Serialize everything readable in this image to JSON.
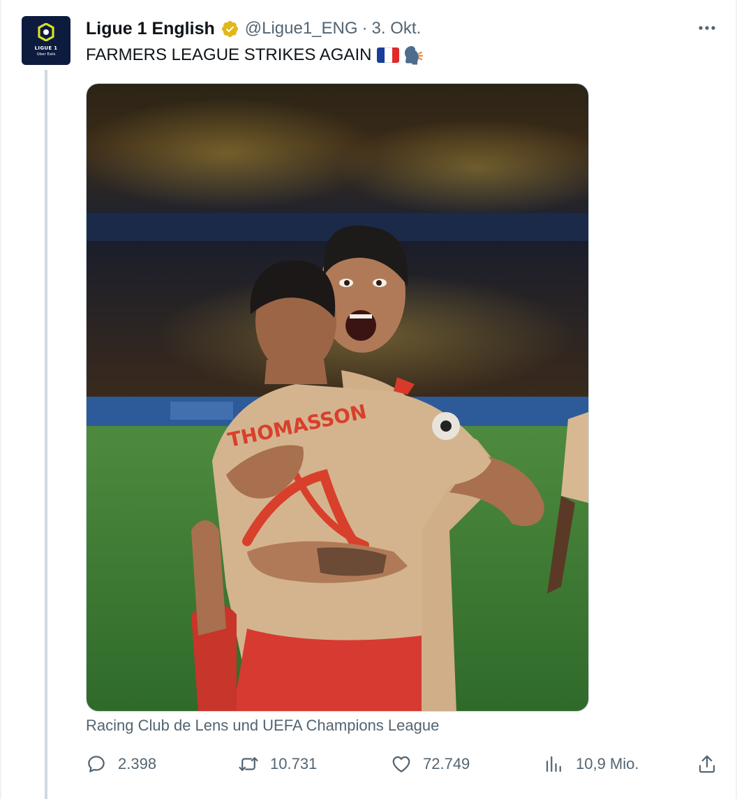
{
  "account": {
    "name": "Ligue 1 English",
    "handle": "@Ligue1_ENG",
    "separator": "·",
    "date": "3. Okt.",
    "avatar_line1": "LIGUE 1",
    "avatar_line2": "Uber Eats"
  },
  "tweet": {
    "text": "FARMERS LEAGUE STRIKES AGAIN",
    "emojis": [
      "flag-france-icon",
      "speaking-head-icon"
    ]
  },
  "media": {
    "jersey_name": "THOMASSON",
    "caption": "Racing Club de Lens und UEFA Champions League"
  },
  "actions": {
    "replies": "2.398",
    "retweets": "10.731",
    "likes": "72.749",
    "views": "10,9 Mio."
  },
  "colors": {
    "text_primary": "#0f1419",
    "text_secondary": "#536471",
    "verified_gold": "#e2b719",
    "avatar_bg": "#0d1b3e",
    "brand_yellow": "#dae025",
    "pitch_green": "#3f7a34"
  }
}
